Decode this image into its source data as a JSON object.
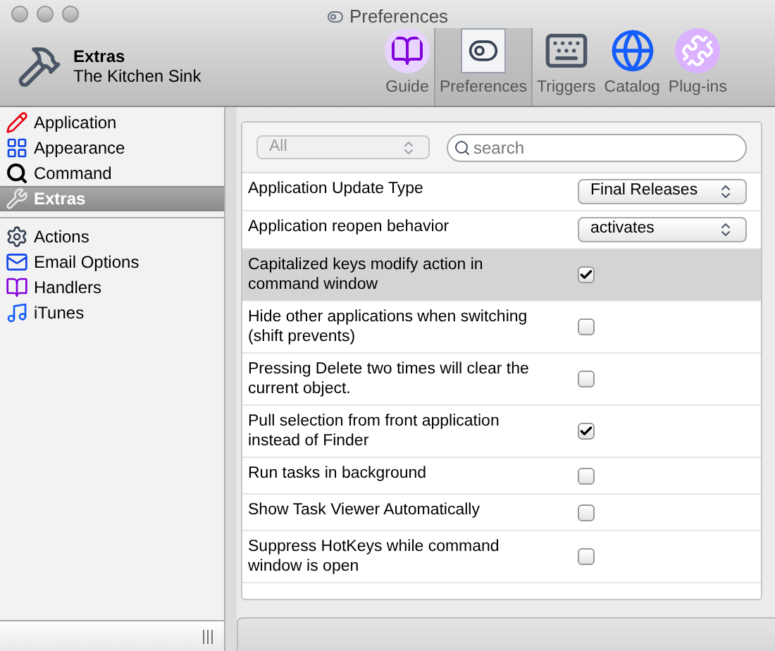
{
  "window": {
    "title": "Preferences"
  },
  "header": {
    "title": "Extras",
    "subtitle": "The Kitchen Sink"
  },
  "toolbar": [
    {
      "label": "Guide",
      "selected": false
    },
    {
      "label": "Preferences",
      "selected": true
    },
    {
      "label": "Triggers",
      "selected": false
    },
    {
      "label": "Catalog",
      "selected": false
    },
    {
      "label": "Plug-ins",
      "selected": false
    }
  ],
  "sidebar": {
    "groups": [
      [
        {
          "label": "Application",
          "selected": false
        },
        {
          "label": "Appearance",
          "selected": false
        },
        {
          "label": "Command",
          "selected": false
        },
        {
          "label": "Extras",
          "selected": true
        }
      ],
      [
        {
          "label": "Actions",
          "selected": false
        },
        {
          "label": "Email Options",
          "selected": false
        },
        {
          "label": "Handlers",
          "selected": false
        },
        {
          "label": "iTunes",
          "selected": false
        }
      ]
    ]
  },
  "filter": {
    "value": "All"
  },
  "search": {
    "placeholder": "search"
  },
  "settings": [
    {
      "label": "Application Update Type",
      "kind": "popup",
      "value": "Final Releases",
      "selected": false
    },
    {
      "label": "Application reopen behavior",
      "kind": "popup",
      "value": "activates",
      "selected": false
    },
    {
      "label": "Capitalized keys modify action in command window",
      "kind": "checkbox",
      "checked": true,
      "selected": true
    },
    {
      "label": "Hide other applications when switching (shift prevents)",
      "kind": "checkbox",
      "checked": false,
      "selected": false
    },
    {
      "label": "Pressing Delete two times will clear the current object.",
      "kind": "checkbox",
      "checked": false,
      "selected": false
    },
    {
      "label": "Pull selection from front application instead of Finder",
      "kind": "checkbox",
      "checked": true,
      "selected": false
    },
    {
      "label": "Run tasks in background",
      "kind": "checkbox",
      "checked": false,
      "selected": false
    },
    {
      "label": "Show Task Viewer Automatically",
      "kind": "checkbox",
      "checked": false,
      "selected": false
    },
    {
      "label": "Suppress HotKeys while command window is open",
      "kind": "checkbox",
      "checked": false,
      "selected": false
    }
  ]
}
